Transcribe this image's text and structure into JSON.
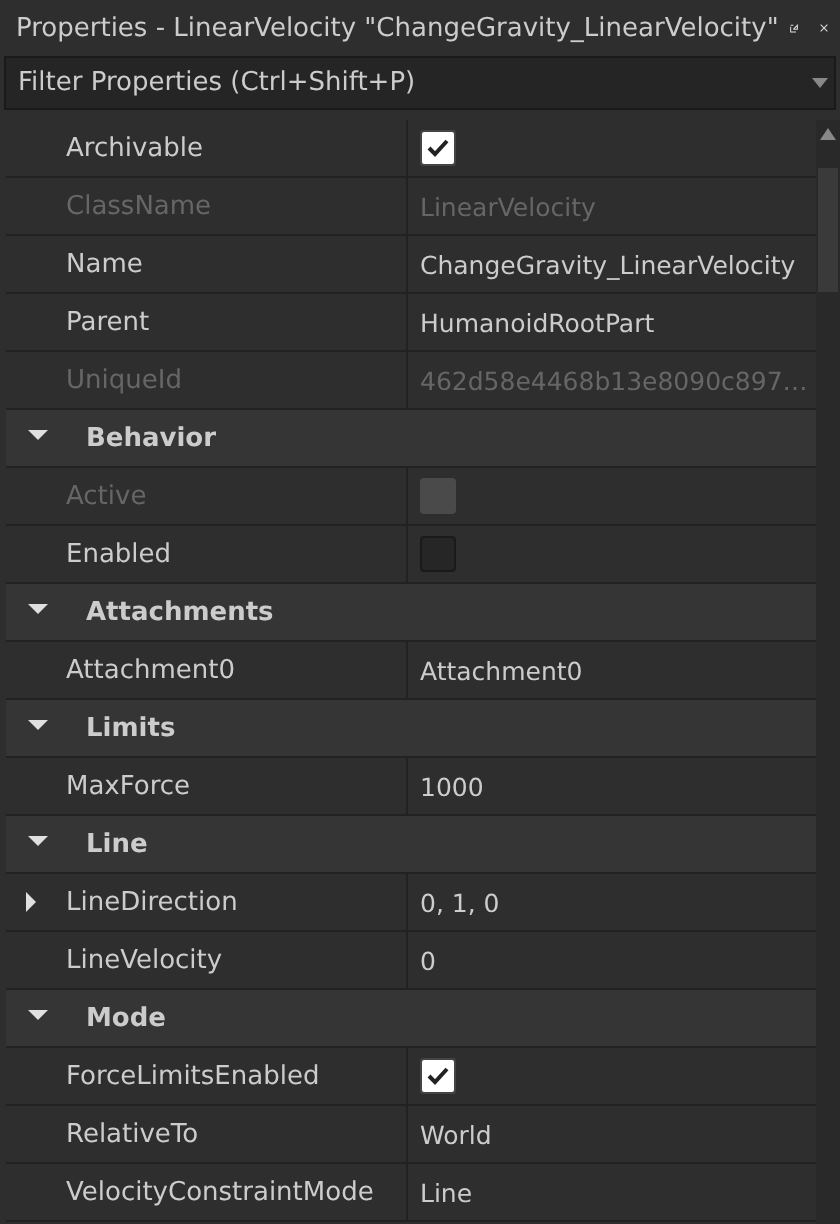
{
  "window": {
    "title": "Properties - LinearVelocity \"ChangeGravity_LinearVelocity\""
  },
  "filter": {
    "placeholder": "Filter Properties (Ctrl+Shift+P)"
  },
  "groups": [
    {
      "properties": [
        {
          "kind": "checkbox",
          "name": "Archivable",
          "checked": true,
          "disabled": false
        },
        {
          "kind": "text",
          "name": "ClassName",
          "value": "LinearVelocity",
          "disabled": true
        },
        {
          "kind": "text",
          "name": "Name",
          "value": "ChangeGravity_LinearVelocity",
          "disabled": false
        },
        {
          "kind": "text",
          "name": "Parent",
          "value": "HumanoidRootPart",
          "disabled": false
        },
        {
          "kind": "text",
          "name": "UniqueId",
          "value": "462d58e4468b13e8090c897…",
          "disabled": true
        }
      ]
    },
    {
      "title": "Behavior",
      "expanded": true,
      "properties": [
        {
          "kind": "checkbox",
          "name": "Active",
          "checked": false,
          "disabled": true
        },
        {
          "kind": "checkbox",
          "name": "Enabled",
          "checked": false,
          "disabled": false
        }
      ]
    },
    {
      "title": "Attachments",
      "expanded": true,
      "properties": [
        {
          "kind": "text",
          "name": "Attachment0",
          "value": "Attachment0",
          "disabled": false
        }
      ]
    },
    {
      "title": "Limits",
      "expanded": true,
      "properties": [
        {
          "kind": "text",
          "name": "MaxForce",
          "value": "1000",
          "disabled": false
        }
      ]
    },
    {
      "title": "Line",
      "expanded": true,
      "properties": [
        {
          "kind": "vector",
          "name": "LineDirection",
          "value": "0, 1, 0",
          "expanded": false,
          "disabled": false
        },
        {
          "kind": "text",
          "name": "LineVelocity",
          "value": "0",
          "disabled": false
        }
      ]
    },
    {
      "title": "Mode",
      "expanded": true,
      "properties": [
        {
          "kind": "checkbox",
          "name": "ForceLimitsEnabled",
          "checked": true,
          "disabled": false
        },
        {
          "kind": "text",
          "name": "RelativeTo",
          "value": "World",
          "disabled": false
        },
        {
          "kind": "text",
          "name": "VelocityConstraintMode",
          "value": "Line",
          "disabled": false
        }
      ]
    }
  ]
}
